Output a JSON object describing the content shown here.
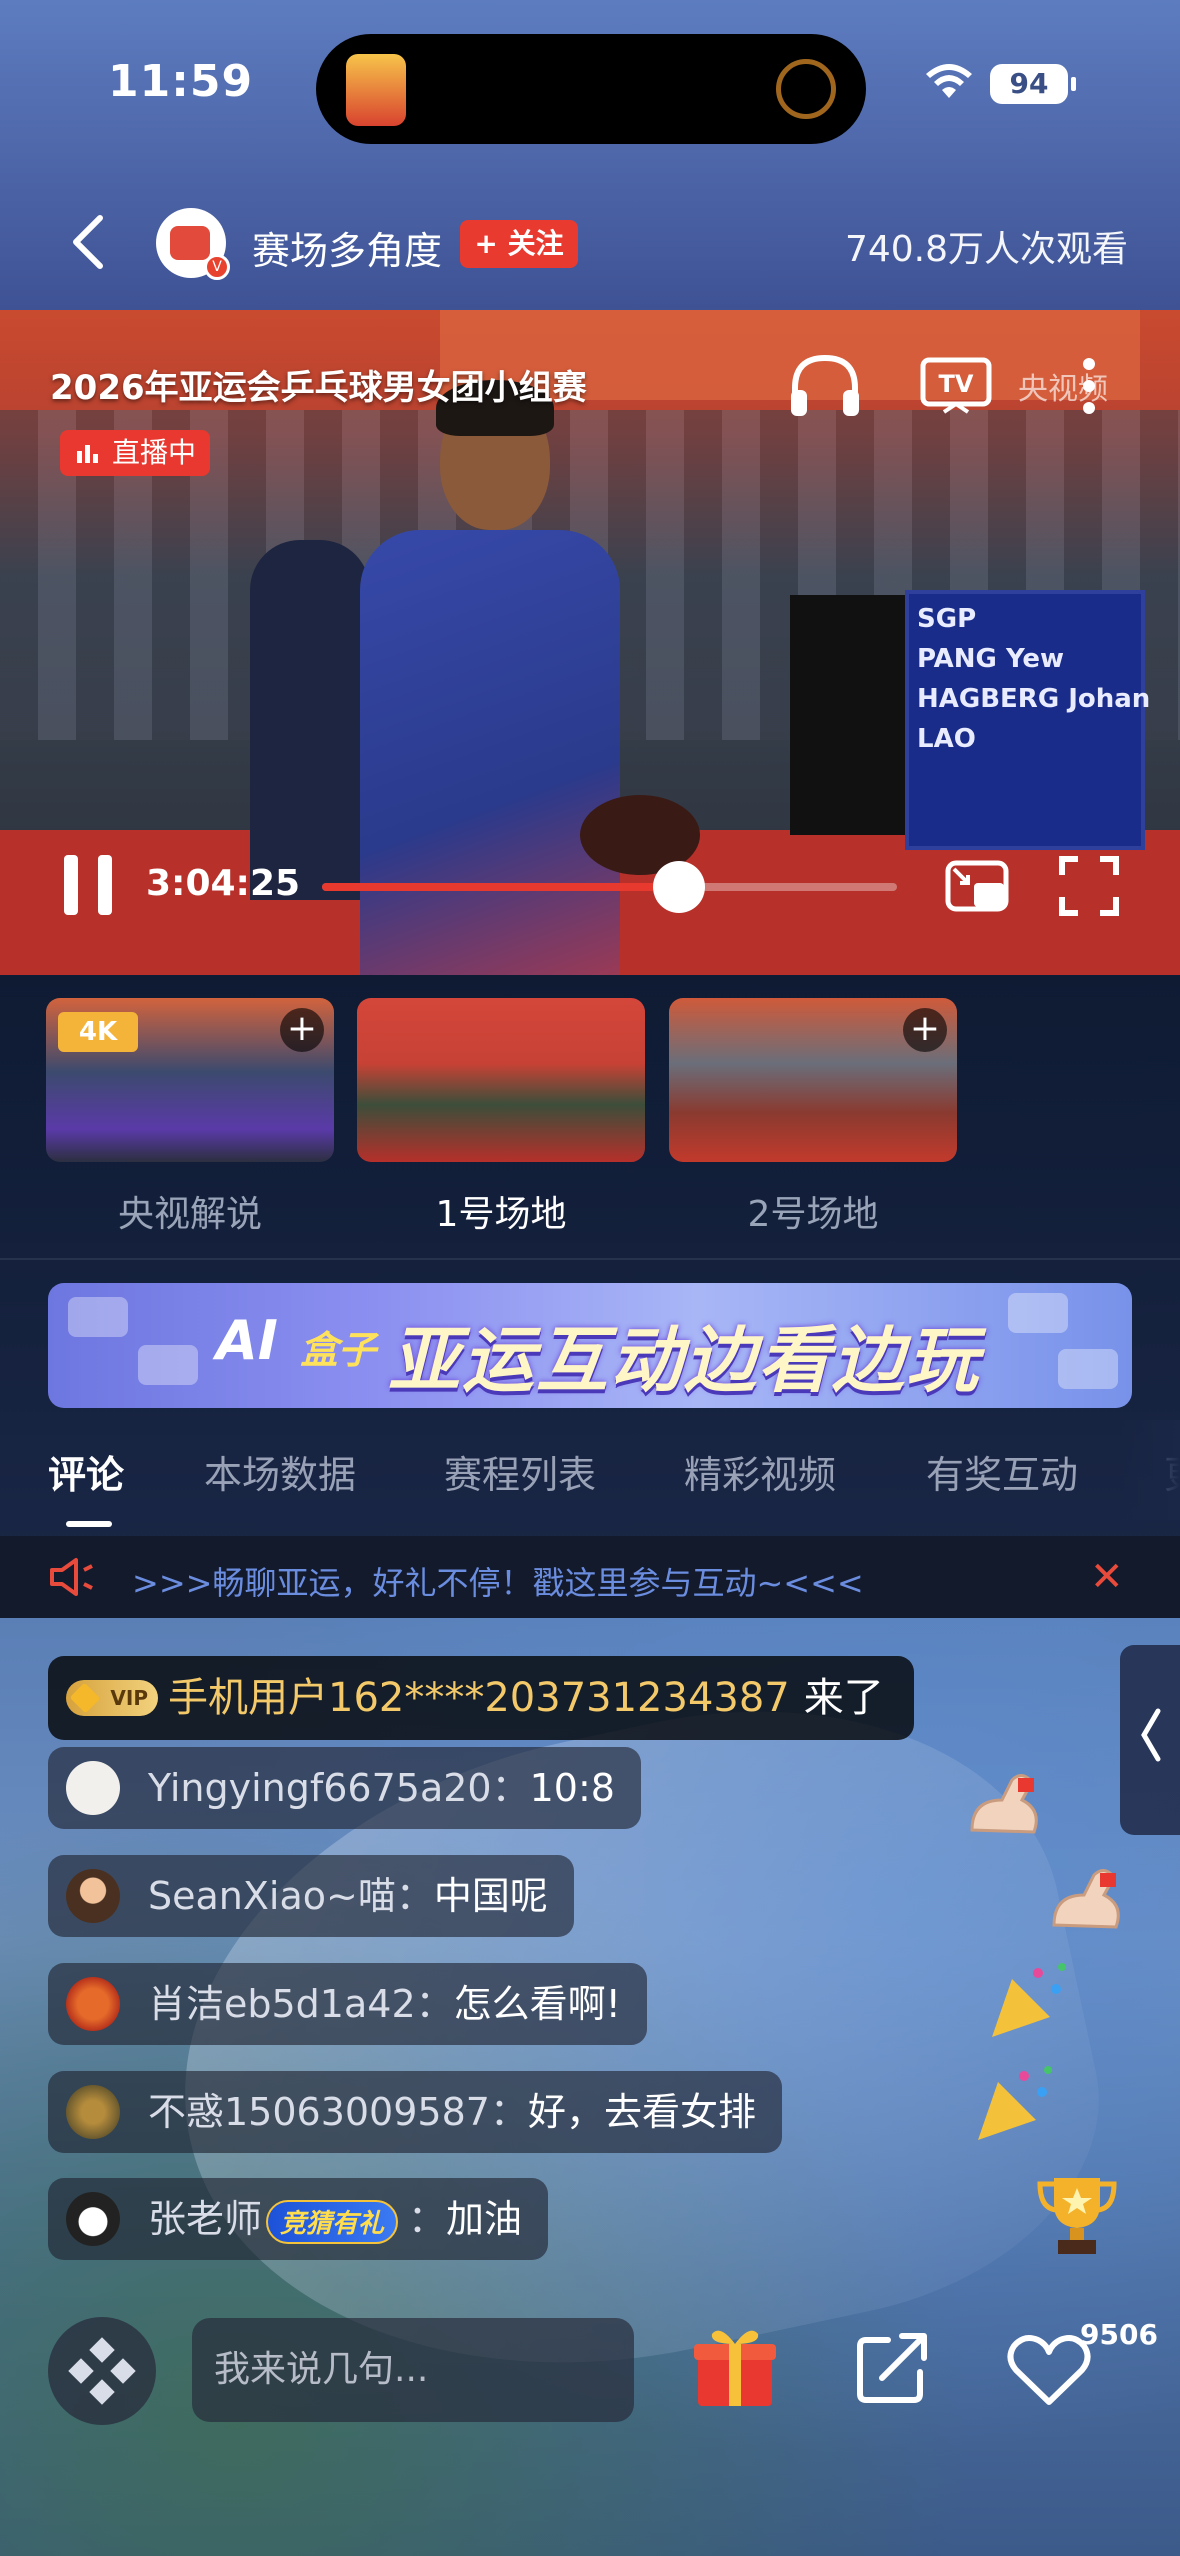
{
  "status_bar": {
    "time": "11:59",
    "battery": "94"
  },
  "header": {
    "channel_name": "赛场多角度",
    "follow_label": "+ 关注",
    "view_count": "740.8万人次观看"
  },
  "video": {
    "title": "2026年亚运会乒乓球男女团小组赛",
    "live_badge": "直播中",
    "watermark": "央视频",
    "current_time": "3:04:25",
    "progress": 0.62,
    "scoreboard": [
      "SGP",
      "PANG Yew",
      "HAGBERG Johan",
      "LAO"
    ]
  },
  "angles": [
    {
      "label": "央视解说",
      "tag": "4K",
      "active": false
    },
    {
      "label": "1号场地",
      "tag": "",
      "active": true
    },
    {
      "label": "2号场地",
      "tag": "",
      "active": false
    }
  ],
  "promo_banner": {
    "ai": "AI",
    "box": "盒子",
    "slogan": "亚运互动边看边玩"
  },
  "tabs": [
    "评论",
    "本场数据",
    "赛程列表",
    "精彩视频",
    "有奖互动",
    "更"
  ],
  "notice": {
    "text": ">>>畅聊亚运，好礼不停！戳这里参与互动~<<<"
  },
  "chat": {
    "enter": {
      "vip_label": "VIP",
      "user": "手机用户162****203731234387",
      "suffix": "来了"
    },
    "messages": [
      {
        "user": "Yingyingf6675a20：",
        "content": "10:8"
      },
      {
        "user": "SeanXiao~喵：",
        "content": "中国呢"
      },
      {
        "user": "肖洁eb5d1a42：",
        "content": "怎么看啊!"
      },
      {
        "user": "不惑15063009587：",
        "content": "好，去看女排"
      },
      {
        "user": "张老师",
        "badge": "竞猜有礼",
        "sep": "：",
        "content": "加油"
      }
    ]
  },
  "bottom_bar": {
    "input_placeholder": "我来说几句...",
    "like_count": "9506"
  },
  "colors": {
    "accent_red": "#e8382f",
    "notice_blue": "#6b8de0",
    "vip_gold": "#f3c969"
  }
}
